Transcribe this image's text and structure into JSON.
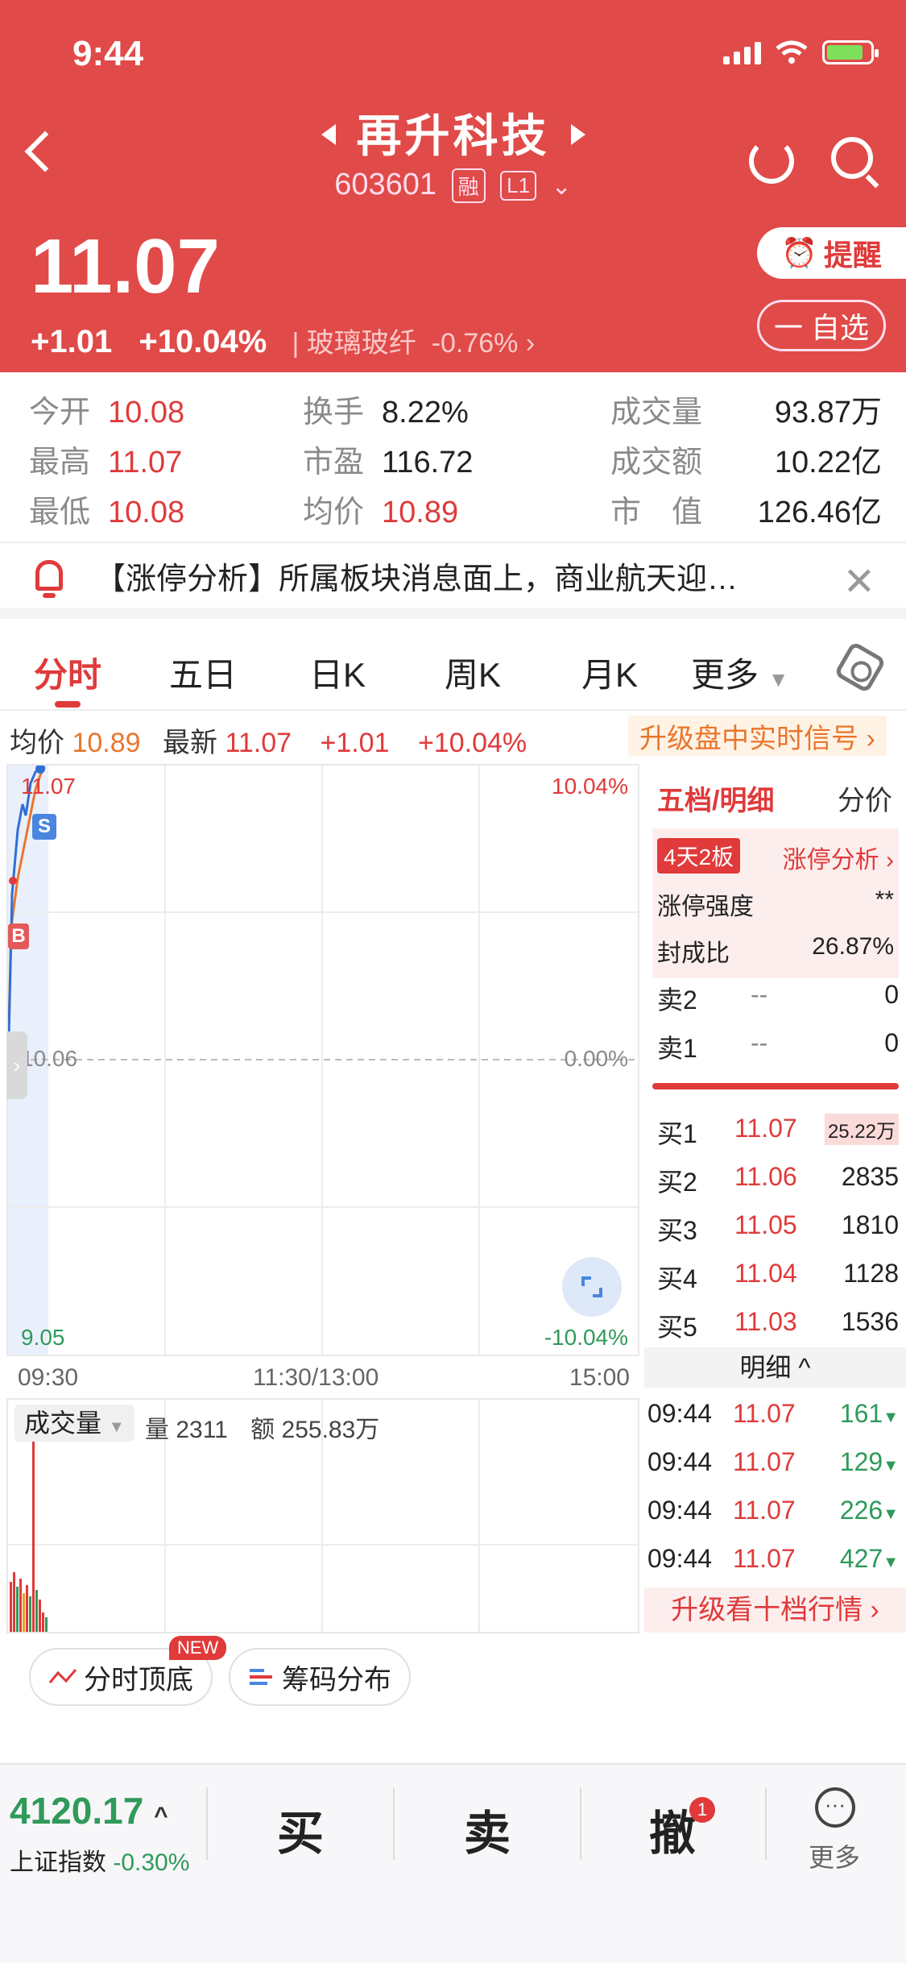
{
  "status_bar": {
    "time": "9:44"
  },
  "header": {
    "stock_name": "再升科技",
    "stock_code": "603601",
    "tag_margin": "融",
    "tag_level": "L1",
    "price": "11.07",
    "change": "+1.01",
    "change_pct": "+10.04%",
    "sector": "玻璃玻纤",
    "sector_change": "-0.76%",
    "remind_label": "提醒",
    "watch_label": "一 自选"
  },
  "stats": {
    "open_label": "今开",
    "open": "10.08",
    "high_label": "最高",
    "high": "11.07",
    "low_label": "最低",
    "low": "10.08",
    "turnover_label": "换手",
    "turnover": "8.22%",
    "pe_label": "市盈",
    "pe": "116.72",
    "avg_label": "均价",
    "avg": "10.89",
    "volume_label": "成交量",
    "volume": "93.87万",
    "amount_label": "成交额",
    "amount": "10.22亿",
    "mcap_label": "市　值",
    "mcap": "126.46亿"
  },
  "alert": {
    "text": "【涨停分析】所属板块消息面上，商业航天迎…",
    "close": "✕"
  },
  "tabs": [
    "分时",
    "五日",
    "日K",
    "周K",
    "月K",
    "更多"
  ],
  "info_line": {
    "avg_label": "均价",
    "avg": "10.89",
    "latest_label": "最新",
    "latest": "11.07",
    "change": "+1.01",
    "change_pct": "+10.04%",
    "upgrade": "升级盘中实时信号 ›"
  },
  "chart": {
    "top_price": "11.07",
    "top_pct": "10.04%",
    "mid_price": "10.06",
    "mid_pct": "0.00%",
    "bottom_price": "9.05",
    "bottom_pct": "-10.04%",
    "marker_s": "S",
    "marker_b": "B",
    "time_start": "09:30",
    "time_mid": "11:30/13:00",
    "time_end": "15:00"
  },
  "volume": {
    "label": "成交量",
    "qty_label": "量",
    "qty": "2311",
    "amt_label": "额",
    "amt": "255.83万"
  },
  "book": {
    "tab1": "五档/明细",
    "tab2": "分价",
    "limit_tag": "4天2板",
    "limit_link": "涨停分析 ›",
    "strength_label": "涨停强度",
    "strength": "**",
    "seal_label": "封成比",
    "seal": "26.87%",
    "asks": [
      {
        "label": "卖2",
        "price": "--",
        "qty": "0"
      },
      {
        "label": "卖1",
        "price": "--",
        "qty": "0"
      }
    ],
    "bids": [
      {
        "label": "买1",
        "price": "11.07",
        "qty": "25.22万"
      },
      {
        "label": "买2",
        "price": "11.06",
        "qty": "2835"
      },
      {
        "label": "买3",
        "price": "11.05",
        "qty": "1810"
      },
      {
        "label": "买4",
        "price": "11.04",
        "qty": "1128"
      },
      {
        "label": "买5",
        "price": "11.03",
        "qty": "1536"
      }
    ],
    "detail_label": "明细 ^",
    "ticks": [
      {
        "time": "09:44",
        "price": "11.07",
        "qty": "161"
      },
      {
        "time": "09:44",
        "price": "11.07",
        "qty": "129"
      },
      {
        "time": "09:44",
        "price": "11.07",
        "qty": "226"
      },
      {
        "time": "09:44",
        "price": "11.07",
        "qty": "427"
      }
    ],
    "upgrade": "升级看十档行情 ›"
  },
  "chips": {
    "chip1": "分时顶底",
    "new_badge": "NEW",
    "chip2": "筹码分布"
  },
  "bottom_bar": {
    "index_value": "4120.17",
    "index_name": "上证指数",
    "index_change": "-0.30%",
    "buy": "买",
    "sell": "卖",
    "cancel": "撤",
    "cancel_badge": "1",
    "more_icon": "···",
    "more": "更多"
  },
  "colors": {
    "header_bg": "#e04a48",
    "up": "#e03a3a",
    "down": "#2f9a5a",
    "accent_orange": "#e9762b"
  }
}
